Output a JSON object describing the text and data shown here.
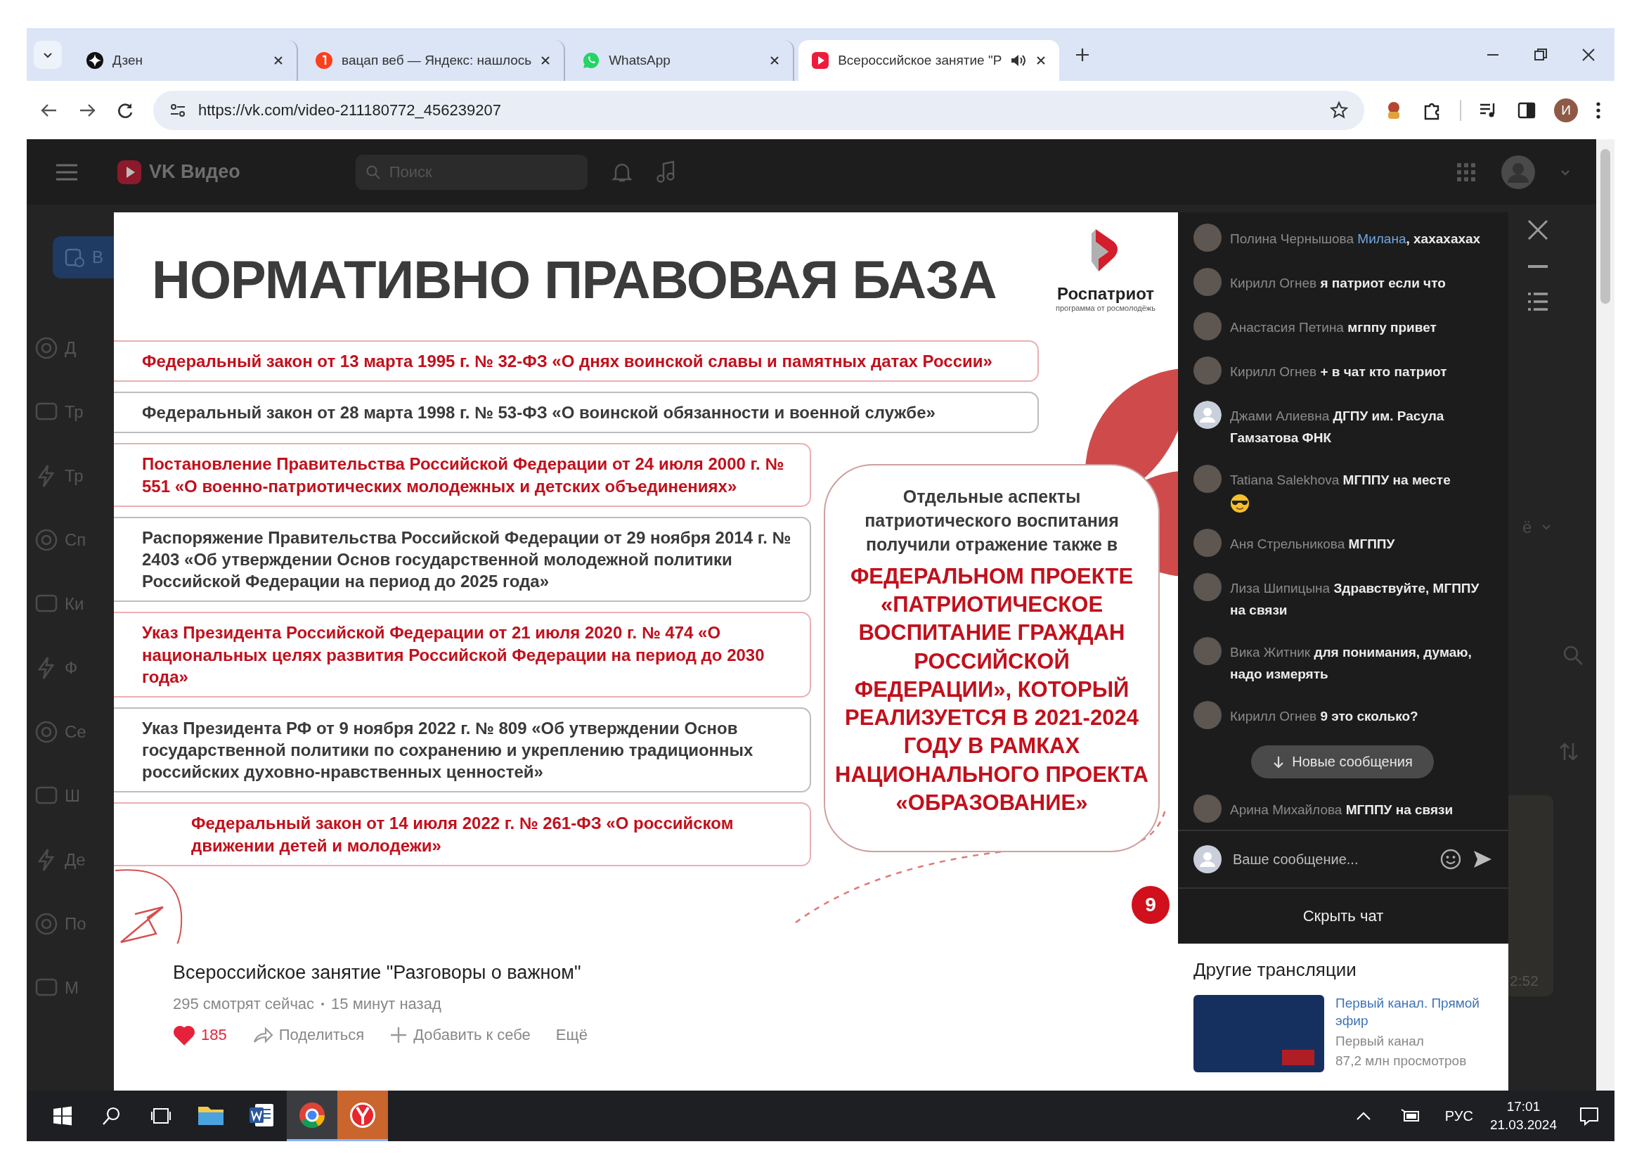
{
  "browser": {
    "tabs": [
      {
        "title": "Дзен",
        "kind": "sparkle",
        "selected": false,
        "audio": false
      },
      {
        "title": "вацап веб — Яндекс: нашлось",
        "kind": "letter",
        "selected": false,
        "audio": false
      },
      {
        "title": "WhatsApp",
        "kind": "chat",
        "selected": false,
        "audio": false
      },
      {
        "title": "Всероссийское занятие \"Р",
        "kind": "play",
        "selected": true,
        "audio": true
      }
    ],
    "url": "https://vk.com/video-211180772_456239207",
    "profile_initial": "И"
  },
  "vk_header": {
    "logo": "VK Видео",
    "search": {
      "placeholder": "Поиск"
    }
  },
  "sidebar": {
    "button_label": "В",
    "items": [
      "Д",
      "Тр",
      "Тр",
      "Сп",
      "Ки",
      "Ф",
      "Се",
      "Ш",
      "Де",
      "По",
      "М"
    ]
  },
  "background_page": {
    "sort_label": "ё",
    "video_duration": "2:52"
  },
  "slide": {
    "title": "НОРМАТИВНО ПРАВОВАЯ БАЗА",
    "logo": {
      "name": "Роспатриот",
      "tagline": "программа от росмолодёжь"
    },
    "laws": [
      {
        "text": "Федеральный закон от 13 марта 1995 г. № 32-ФЗ «О днях воинской славы и памятных датах России»",
        "color": "#c2101c"
      },
      {
        "text": "Федеральный закон от 28 марта 1998 г. № 53-ФЗ «О воинской обязанности и военной службе»",
        "color": "#3a3a3a"
      },
      {
        "text": "Постановление Правительства Российской Федерации от 24 июля 2000 г. № 551 «О военно-патриотических молодежных и детских объединениях»",
        "color": "#c2101c"
      },
      {
        "text": "Распоряжение Правительства Российской Федерации от 29 ноября 2014 г. № 2403 «Об утверждении Основ государственной молодежной политики Российской Федерации на период до 2025 года»",
        "color": "#3a3a3a"
      },
      {
        "text": "Указ Президента Российской Федерации от 21 июля 2020 г. № 474 «О национальных целях развития Российской Федерации на период до 2030 года»",
        "color": "#c2101c"
      },
      {
        "text": "Указ Президента РФ от 9 ноября 2022 г. № 809 «Об утверждении Основ государственной политики по сохранению и укреплению традиционных российских духовно-нравственных ценностей»",
        "color": "#3a3a3a"
      },
      {
        "text": "Федеральный закон от 14 июля 2022 г. № 261-ФЗ «О российском движении детей и молодежи»",
        "color": "#c2101c"
      }
    ],
    "aspects": {
      "intro": "Отдельные аспекты патриотического воспитания получили отражение также в",
      "highlight": "ФЕДЕРАЛЬНОМ ПРОЕКТЕ «ПАТРИОТИЧЕСКОЕ ВОСПИТАНИЕ ГРАЖДАН РОССИЙСКОЙ ФЕДЕРАЦИИ», КОТОРЫЙ РЕАЛИЗУЕТСЯ В 2021-2024 ГОДУ В РАМКАХ НАЦИОНАЛЬНОГО ПРОЕКТА «ОБРАЗОВАНИЕ»"
    },
    "page_number": "9"
  },
  "video": {
    "title": "Всероссийское занятие \"Разговоры о важном\"",
    "viewers": "295 смотрят сейчас",
    "time": "15 минут назад",
    "likes": "185",
    "liked": true,
    "actions": [
      "Поделиться",
      "Добавить к себе",
      "Ещё"
    ]
  },
  "chat": {
    "messages": [
      {
        "author": "Полина Чернышова",
        "default_avatar": false,
        "emoji": false,
        "mention": "Милана",
        "text": ", хахахахах"
      },
      {
        "author": "Кирилл Огнев",
        "default_avatar": false,
        "emoji": false,
        "text": "я патриот если что"
      },
      {
        "author": "Анастасия Петина",
        "default_avatar": false,
        "emoji": false,
        "text": "мгппу привет"
      },
      {
        "author": "Кирилл Огнев",
        "default_avatar": false,
        "emoji": false,
        "text": "+ в чат кто патриот"
      },
      {
        "author": "Джами Алиевна",
        "default_avatar": true,
        "emoji": false,
        "text": "ДГПУ им. Расула Гамзатова ФНК"
      },
      {
        "author": "Tatiana Salekhova",
        "default_avatar": false,
        "emoji": true,
        "text": "МГППУ на месте"
      },
      {
        "author": "Аня Стрельникова",
        "default_avatar": false,
        "emoji": false,
        "text": "МГППУ"
      },
      {
        "author": "Лиза Шипицына",
        "default_avatar": false,
        "emoji": false,
        "text": "Здравствуйте, МГППУ на связи"
      },
      {
        "author": "Вика Житник",
        "default_avatar": false,
        "emoji": false,
        "text": "для понимания, думаю, надо измерять"
      },
      {
        "author": "Кирилл Огнев",
        "default_avatar": false,
        "emoji": false,
        "text": "9 это сколько?"
      },
      {
        "author": "Арина Михайлова",
        "default_avatar": false,
        "emoji": false,
        "text": "МГППУ на связи"
      }
    ],
    "new_messages": "Новые сообщения",
    "input": {
      "placeholder": "Ваше сообщение..."
    },
    "hide": "Скрыть чат"
  },
  "other_streams": {
    "title": "Другие трансляции",
    "items": [
      {
        "title": "Первый канал. Прямой эфир",
        "channel": "Первый канал",
        "views": "87,2 млн просмотров",
        "live": true
      }
    ]
  },
  "taskbar": {
    "apps": [
      {
        "kind": "explorer",
        "active": false
      },
      {
        "kind": "word",
        "active": false
      },
      {
        "kind": "chrome",
        "active": true
      },
      {
        "kind": "yandex",
        "active": true
      }
    ],
    "language": "РУС",
    "time": "17:01",
    "date": "21.03.2024"
  }
}
